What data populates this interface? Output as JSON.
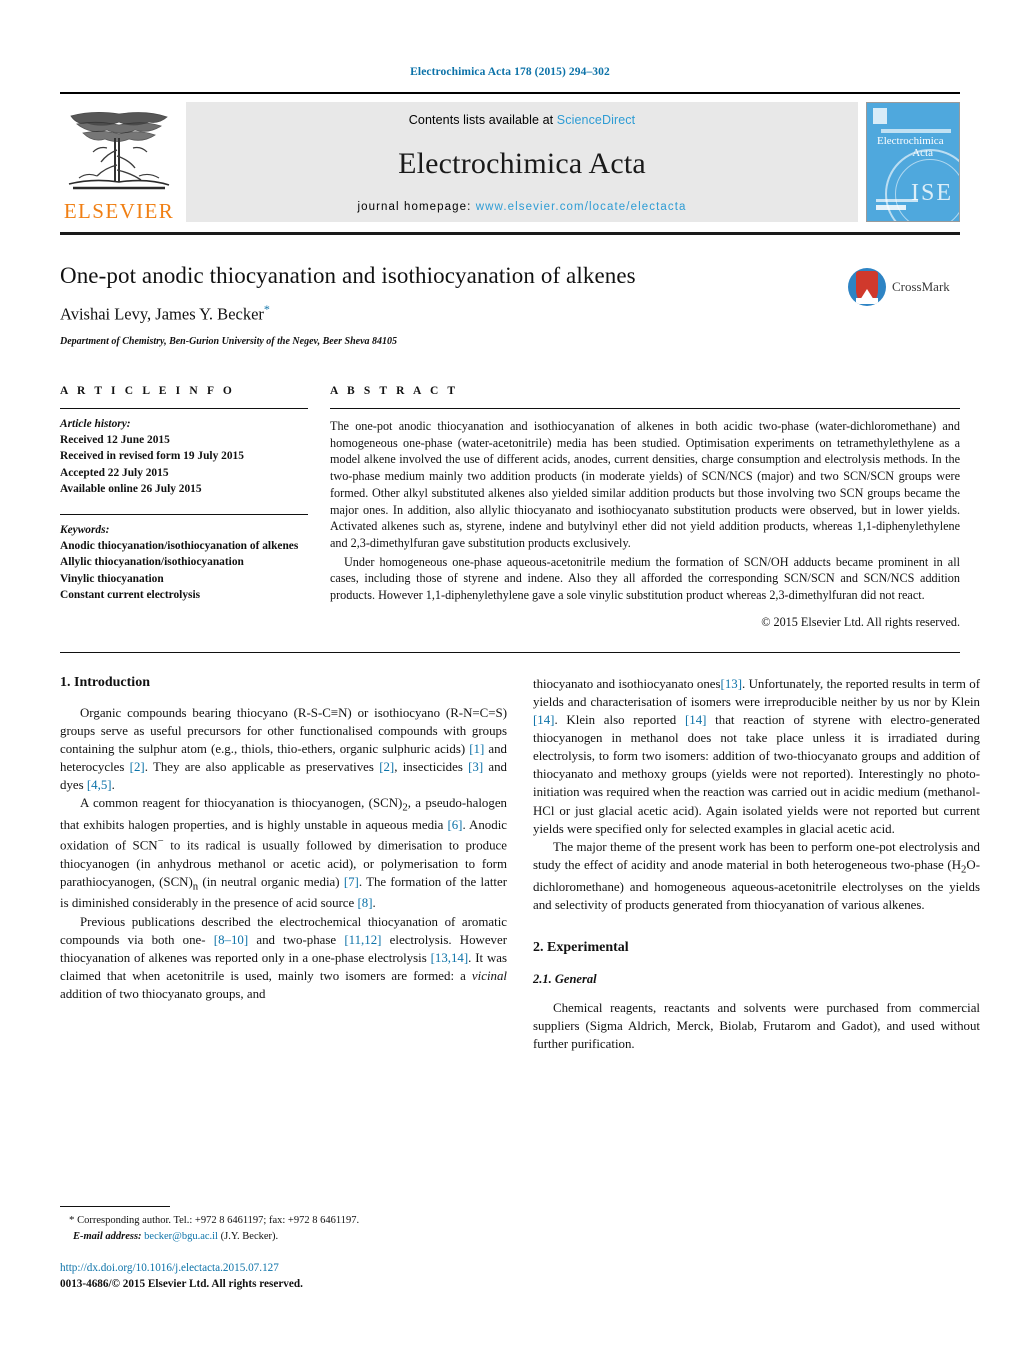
{
  "running_head": "Electrochimica Acta 178 (2015) 294–302",
  "masthead": {
    "publisher": "ELSEVIER",
    "contents_prefix": "Contents lists available at ",
    "contents_link": "ScienceDirect",
    "journal_title": "Electrochimica Acta",
    "homepage_prefix": "journal homepage: ",
    "homepage_url": "www.elsevier.com/locate/electacta",
    "cover_title_line1": "Electrochimica",
    "cover_title_line2": "Acta",
    "cover_seal_text": "ISE"
  },
  "article": {
    "title": "One-pot anodic thiocyanation and isothiocyanation of alkenes",
    "authors": "Avishai Levy, James Y. Becker",
    "author_star": "*",
    "affiliation": "Department of Chemistry, Ben-Gurion University of the Negev, Beer Sheva 84105",
    "crossmark_label": "CrossMark"
  },
  "article_info": {
    "heading": "A R T I C L E   I N F O",
    "history_label": "Article history:",
    "history": [
      "Received 12 June 2015",
      "Received in revised form 19 July 2015",
      "Accepted 22 July 2015",
      "Available online 26 July 2015"
    ],
    "keywords_label": "Keywords:",
    "keywords": [
      "Anodic thiocyanation/isothiocyanation of alkenes",
      "Allylic thiocyanation/isothiocyanation",
      "Vinylic thiocyanation",
      "Constant current electrolysis"
    ]
  },
  "abstract": {
    "heading": "A B S T R A C T",
    "paragraph1": "The one-pot anodic thiocyanation and isothiocyanation of alkenes in both acidic two-phase (water-dichloromethane) and homogeneous one-phase (water-acetonitrile) media has been studied. Optimisation experiments on tetramethylethylene as a model alkene involved the use of different acids, anodes, current densities, charge consumption and electrolysis methods. In the two-phase medium mainly two addition products (in moderate yields) of SCN/NCS (major) and two SCN/SCN groups were formed. Other alkyl substituted alkenes also yielded similar addition products but those involving two SCN groups became the major ones. In addition, also allylic thiocyanato and isothiocyanato substitution products were observed, but in lower yields. Activated alkenes such as, styrene, indene and butylvinyl ether did not yield addition products, whereas 1,1-diphenylethylene and 2,3-dimethylfuran gave substitution products exclusively.",
    "paragraph2": "Under homogeneous one-phase aqueous-acetonitrile medium the formation of SCN/OH adducts became prominent in all cases, including those of styrene and indene. Also they all afforded the corresponding SCN/SCN and SCN/NCS addition products. However 1,1-diphenylethylene gave a sole vinylic substitution product whereas 2,3-dimethylfuran did not react.",
    "copyright": "© 2015 Elsevier Ltd. All rights reserved."
  },
  "sections": {
    "intro_heading": "1.  Introduction",
    "experimental_heading": "2.  Experimental",
    "general_heading": "2.1.  General"
  },
  "body": {
    "left": {
      "p1_a": "Organic compounds bearing thiocyano (R-S-C≡N) or isothiocyano (R-N=C=S) groups serve as useful precursors for other functionalised compounds with groups containing the sulphur atom (e.g., thiols, thio-ethers, organic sulphuric acids) ",
      "p1_r1": "[1]",
      "p1_b": " and heterocycles ",
      "p1_r2": "[2]",
      "p1_c": ". They are also applicable as preservatives ",
      "p1_r3": "[2]",
      "p1_d": ", insecticides ",
      "p1_r4": "[3]",
      "p1_e": " and dyes ",
      "p1_r5": "[4,5]",
      "p1_f": ".",
      "p2_a": "A common reagent for thiocyanation is thiocyanogen, (SCN)",
      "p2_sub1": "2",
      "p2_b": ", a pseudo-halogen that exhibits halogen properties, and is highly unstable in aqueous media ",
      "p2_r1": "[6]",
      "p2_c": ". Anodic oxidation of SCN",
      "p2_sup1": "−",
      "p2_d": " to its radical is usually followed by dimerisation to produce thiocyanogen (in anhydrous methanol or acetic acid), or polymerisation to form parathiocyanogen, (SCN)",
      "p2_sub2": "n",
      "p2_e": " (in neutral organic media) ",
      "p2_r2": "[7]",
      "p2_f": ". The formation of the latter is diminished considerably in the presence of acid source ",
      "p2_r3": "[8]",
      "p2_g": ".",
      "p3_a": "Previous publications described the electrochemical thiocyanation of aromatic compounds via both one- ",
      "p3_r1": "[8–10]",
      "p3_b": " and two-phase ",
      "p3_r2": "[11,12]",
      "p3_c": " electrolysis. However thiocyanation of alkenes was reported only in a one-phase electrolysis ",
      "p3_r3": "[13,14]",
      "p3_d": ". It was claimed that when acetonitrile is used, mainly two isomers are formed: a ",
      "p3_ital": "vicinal",
      "p3_e": " addition of two thiocyanato groups, and"
    },
    "right": {
      "p1_a": "thiocyanato and isothiocyanato ones",
      "p1_r1": "[13]",
      "p1_b": ". Unfortunately, the reported results in term of yields and characterisation of isomers were irreproducible neither by us nor by Klein ",
      "p1_r2": "[14]",
      "p1_c": ". Klein also reported ",
      "p1_r3": "[14]",
      "p1_d": " that reaction of styrene with electro-generated thiocyanogen in methanol does not take place unless it is irradiated during electrolysis, to form two isomers: addition of two-thiocyanato groups and addition of thiocyanato and methoxy groups (yields were not reported). Interestingly no photo-initiation was required when the reaction was carried out in acidic medium (methanol-HCl or just glacial acetic acid). Again isolated yields were not reported but current yields were specified only for selected examples in glacial acetic acid.",
      "p2_a": "The major theme of the present work has been to perform one-pot electrolysis and study the effect of acidity and anode material in both heterogeneous two-phase (H",
      "p2_sub1": "2",
      "p2_b": "O-dichloromethane) and homogeneous aqueous-acetonitrile electrolyses on the yields and selectivity of products generated from thiocyanation of various alkenes.",
      "p3": "Chemical reagents, reactants and solvents were purchased from commercial suppliers (Sigma Aldrich, Merck, Biolab, Frutarom and Gadot), and used without further purification."
    }
  },
  "footnote": {
    "star": "*",
    "corresponding": " Corresponding author. Tel.: +972 8 6461197; fax: +972 8 6461197.",
    "email_label": "E-mail address:",
    "email": "becker@bgu.ac.il",
    "email_suffix": " (J.Y. Becker).",
    "doi": "http://dx.doi.org/10.1016/j.electacta.2015.07.127",
    "issn_line": "0013-4686/© 2015 Elsevier Ltd. All rights reserved."
  },
  "colors": {
    "link": "#0c72a8",
    "sciencedirect": "#2e9cd4",
    "elsevier_orange": "#f07f13",
    "cover_blue": "#4fa8dd"
  }
}
